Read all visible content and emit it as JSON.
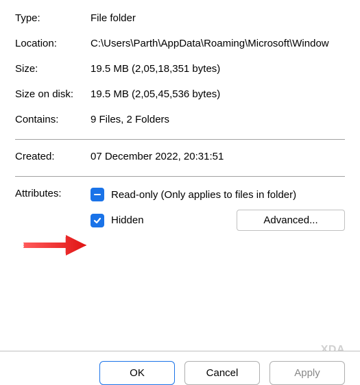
{
  "fields": {
    "type_label": "Type:",
    "type_value": "File folder",
    "location_label": "Location:",
    "location_value": "C:\\Users\\Parth\\AppData\\Roaming\\Microsoft\\Window",
    "size_label": "Size:",
    "size_value": "19.5 MB (2,05,18,351 bytes)",
    "sizeondisk_label": "Size on disk:",
    "sizeondisk_value": "19.5 MB (2,05,45,536 bytes)",
    "contains_label": "Contains:",
    "contains_value": "9 Files, 2 Folders",
    "created_label": "Created:",
    "created_value": "07 December 2022, 20:31:51"
  },
  "attributes": {
    "label": "Attributes:",
    "readonly_label": "Read-only (Only applies to files in folder)",
    "readonly_state": "indeterminate",
    "hidden_label": "Hidden",
    "hidden_state": "checked",
    "advanced_label": "Advanced..."
  },
  "buttons": {
    "ok": "OK",
    "cancel": "Cancel",
    "apply": "Apply"
  },
  "watermark": "XDA"
}
